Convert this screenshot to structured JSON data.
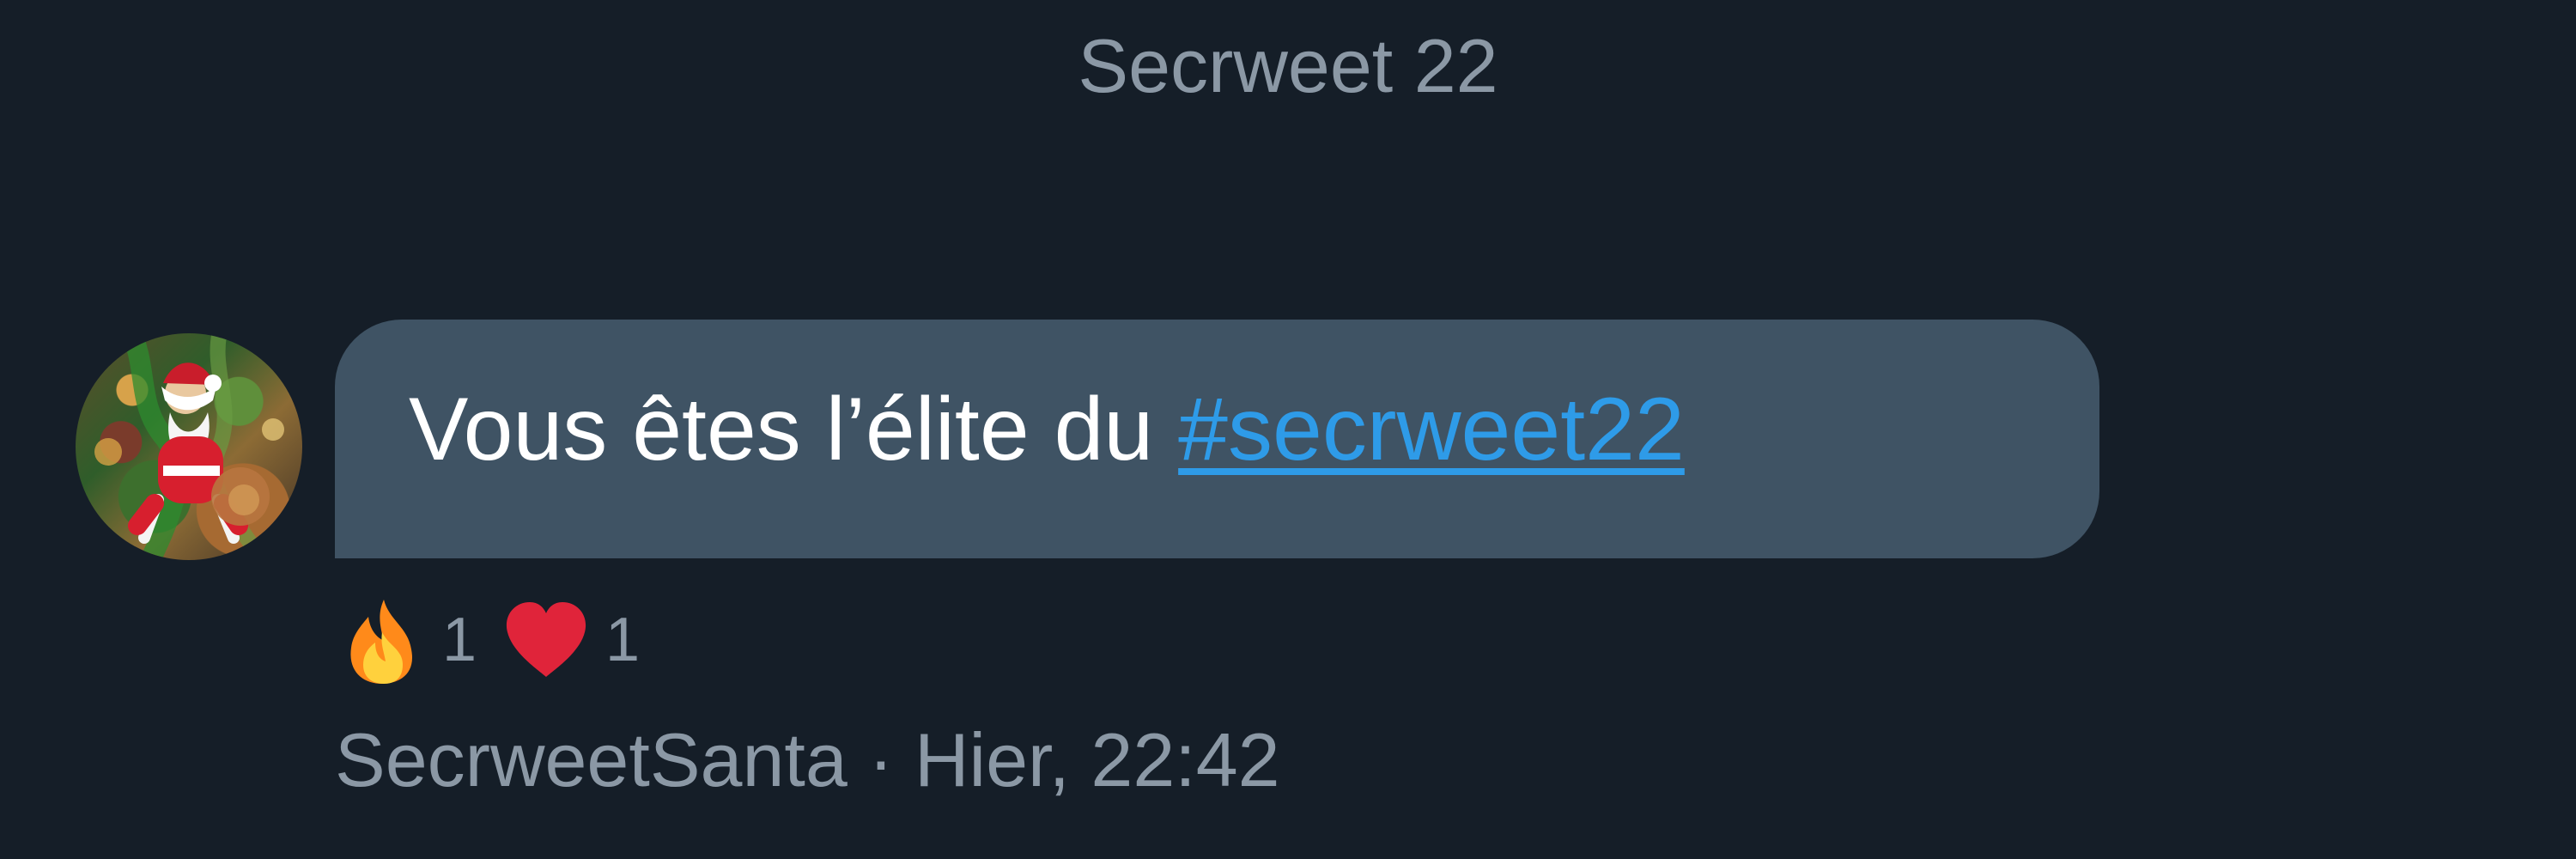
{
  "header": {
    "title": "Secrweet 22"
  },
  "message": {
    "text_prefix": "Vous êtes l’élite du ",
    "hashtag": "#secrweet22",
    "author": "SecrweetSanta",
    "separator": " · ",
    "timestamp": "Hier, 22:42",
    "avatar_icon": "santa-avatar-icon"
  },
  "reactions": [
    {
      "icon": "fire-icon",
      "count": "1"
    },
    {
      "icon": "heart-icon",
      "count": "1"
    }
  ],
  "colors": {
    "background": "#151e28",
    "bubble": "#3f5364",
    "text": "#ffffff",
    "muted": "#8b98a5",
    "link": "#2e9be8",
    "heart": "#e0243a",
    "fire": "#ff8a1a"
  }
}
